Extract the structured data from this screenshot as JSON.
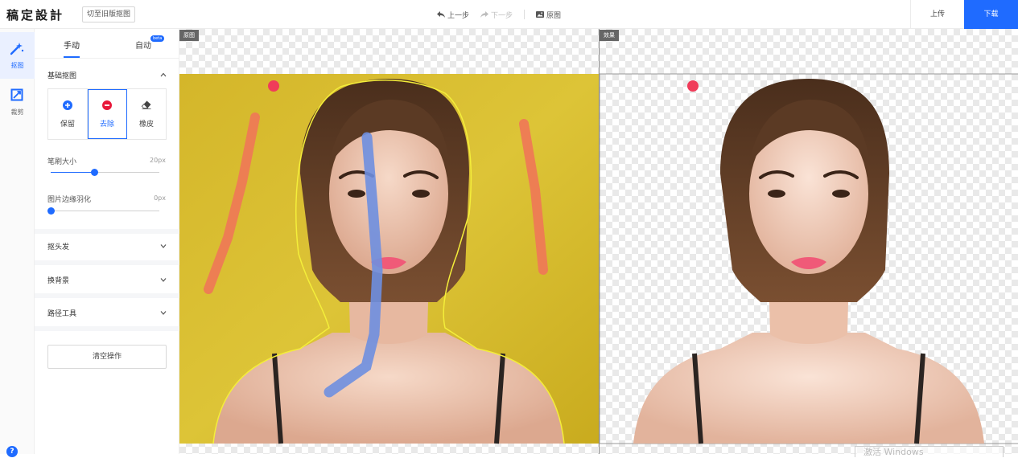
{
  "app": {
    "logo": "稿定設計",
    "switch_old_label": "切至旧版抠图"
  },
  "toolbar": {
    "undo_label": "上一步",
    "redo_label": "下一步",
    "original_label": "原图",
    "upload_label": "上传",
    "download_label": "下载"
  },
  "rail": {
    "items": [
      {
        "label": "抠图",
        "icon": "magic-wand-icon",
        "active": true
      },
      {
        "label": "裁剪",
        "icon": "crop-icon",
        "active": false
      }
    ],
    "help_label": "?"
  },
  "panel": {
    "tabs": [
      {
        "label": "手动",
        "active": true
      },
      {
        "label": "自动",
        "badge": "beta",
        "active": false
      }
    ],
    "basic_section": {
      "title": "基础抠图",
      "modes": [
        {
          "label": "保留",
          "icon": "plus-circle-icon",
          "active": false
        },
        {
          "label": "去除",
          "icon": "minus-circle-icon",
          "active": true
        },
        {
          "label": "橡皮",
          "icon": "eraser-icon",
          "active": false
        }
      ],
      "brush_size": {
        "label": "笔刷大小",
        "value_text": "20px",
        "fraction": 0.4
      },
      "feather": {
        "label": "图片边缘羽化",
        "value_text": "0px",
        "fraction": 0.0
      }
    },
    "sections": [
      {
        "title": "抠头发"
      },
      {
        "title": "换背景"
      },
      {
        "title": "路径工具"
      }
    ],
    "clear_label": "清空操作"
  },
  "canvas": {
    "original_tag": "原图",
    "result_tag": "效果"
  },
  "colors": {
    "accent": "#1f6bff",
    "keep_stroke": "#6e8fe0",
    "remove_stroke": "#ee7a55",
    "background_yellow": "#d8bd2a",
    "marker_red": "#f03c5a"
  },
  "watermark": "激活 Windows"
}
